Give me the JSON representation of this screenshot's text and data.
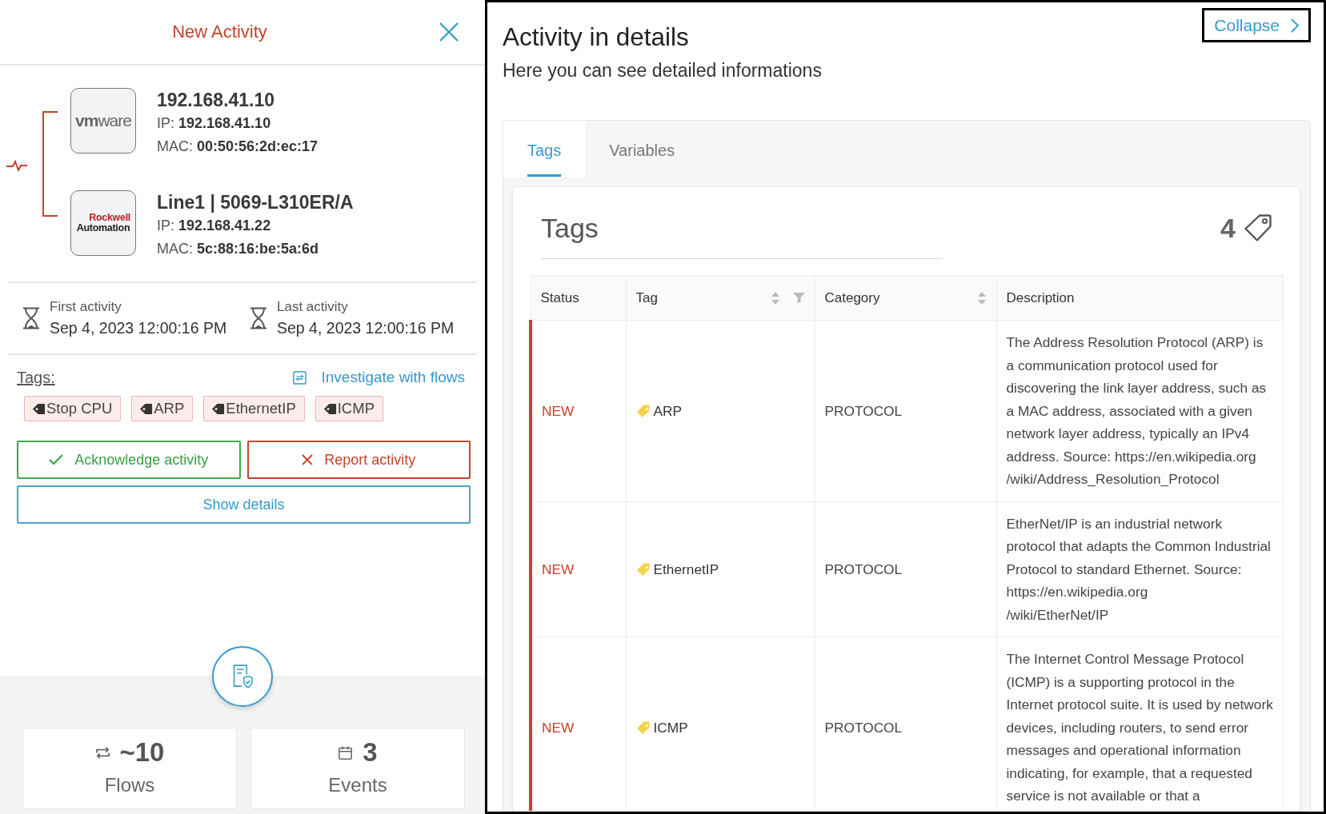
{
  "side_panel": {
    "title": "New Activity",
    "devices": [
      {
        "logo": {
          "kind": "wordmark",
          "lines": [
            "**vm**ware"
          ]
        },
        "name": "192.168.41.10",
        "details": [
          {
            "label": "IP:",
            "value": "192.168.41.10"
          },
          {
            "label": "MAC:",
            "value": "00:50:56:2d:ec:17"
          }
        ]
      },
      {
        "logo": {
          "kind": "stacked",
          "lines": [
            "Rockwell",
            "Automation"
          ]
        },
        "name": "Line1 | 5069-L310ER/A",
        "details": [
          {
            "label": "IP:",
            "value": "192.168.41.22"
          },
          {
            "label": "MAC:",
            "value": "5c:88:16:be:5a:6d"
          }
        ]
      }
    ],
    "activity": [
      {
        "label": "First activity",
        "time": "Sep 4, 2023 12:00:16 PM"
      },
      {
        "label": "Last activity",
        "time": "Sep 4, 2023 12:00:16 PM"
      }
    ],
    "tags_label": "Tags:",
    "investigate_link": "Investigate with flows",
    "tags": [
      "Stop CPU",
      "ARP",
      "EthernetIP",
      "ICMP"
    ],
    "actions": [
      {
        "kind": "acknowledge",
        "label": "Acknowledge activity"
      },
      {
        "kind": "report",
        "label": "Report activity"
      },
      {
        "kind": "details",
        "label": "Show details"
      }
    ],
    "stats": [
      {
        "kind": "flows",
        "value": "~10",
        "label": "Flows"
      },
      {
        "kind": "events",
        "value": "3",
        "label": "Events"
      }
    ]
  },
  "details_panel": {
    "title": "Activity in details",
    "subtitle": "Here you can see detailed informations",
    "collapse_button": "Collapse",
    "tabs": [
      {
        "label": "Tags",
        "selected": true
      },
      {
        "label": "Variables",
        "selected": false
      }
    ],
    "card": {
      "title": "Tags",
      "count": "4"
    },
    "table": {
      "columns": [
        {
          "label": "Status",
          "sortable": false,
          "filterable": false
        },
        {
          "label": "Tag",
          "sortable": true,
          "filterable": true
        },
        {
          "label": "Category",
          "sortable": true,
          "filterable": false
        },
        {
          "label": "Description",
          "sortable": false,
          "filterable": false
        }
      ],
      "rows": [
        {
          "status": "NEW",
          "tag": "ARP",
          "category": "PROTOCOL",
          "description": "The Address Resolution Protocol (ARP) is a communication protocol used for discovering the link layer address, such as a MAC address, associated with a given network layer address, typically an IPv4 address. Source: https://en.wikipedia.org\n/wiki/Address_Resolution_Protocol"
        },
        {
          "status": "NEW",
          "tag": "EthernetIP",
          "category": "PROTOCOL",
          "description": "EtherNet/IP is an industrial network protocol that adapts the Common Industrial Protocol to standard Ethernet. Source: https://en.wikipedia.org\n/wiki/EtherNet/IP"
        },
        {
          "status": "NEW",
          "tag": "ICMP",
          "category": "PROTOCOL",
          "description": "The Internet Control Message Protocol (ICMP) is a supporting protocol in the Internet protocol suite. It is used by network devices, including routers, to send error messages and operational information indicating, for example, that a requested service is not available or that a"
        }
      ]
    }
  }
}
